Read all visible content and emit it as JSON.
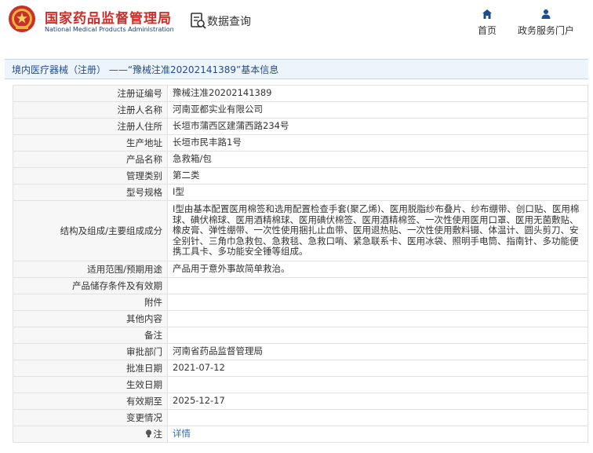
{
  "header": {
    "brand_cn": "国家药品监督管理局",
    "brand_en": "National Medical Products Administration",
    "query_label": "数据查询",
    "nav_home": "首页",
    "nav_portal": "政务服务门户",
    "colors": {
      "brand_red": "#c9302c",
      "brand_blue": "#1b3f8f"
    }
  },
  "title_bar": "境内医疗器械（注册） ——“豫械注准20202141389”基本信息",
  "rows": [
    {
      "label": "注册证编号",
      "value": "豫械注准20202141389"
    },
    {
      "label": "注册人名称",
      "value": "河南亚都实业有限公司"
    },
    {
      "label": "注册人住所",
      "value": "长垣市蒲西区建蒲西路234号"
    },
    {
      "label": "生产地址",
      "value": "长垣市民丰路1号"
    },
    {
      "label": "产品名称",
      "value": "急救箱/包"
    },
    {
      "label": "管理类别",
      "value": "第二类"
    },
    {
      "label": "型号规格",
      "value": "Ⅰ型"
    },
    {
      "label": "结构及组成/主要组成成分",
      "value": "Ⅰ型由基本配置医用棉签和选用配置检查手套(聚乙烯)、医用脱脂纱布叠片、纱布绷带、创口贴、医用棉球、碘伏棉球、医用酒精棉球、医用碘伏棉签、医用酒精棉签、一次性使用医用口罩、医用无菌敷贴、橡皮膏、弹性绷带、一次性使用捆扎止血带、医用退热贴、一次性使用敷料镊、体温计、圆头剪刀、安全别针、三角巾急救包、急救毯、急救口哨、紧急联系卡、医用冰袋、照明手电筒、指南针、多功能便携工具卡、多功能安全锤等组成。"
    },
    {
      "label": "适用范围/预期用途",
      "value": "产品用于意外事故简单救治。"
    },
    {
      "label": "产品储存条件及有效期",
      "value": ""
    },
    {
      "label": "附件",
      "value": ""
    },
    {
      "label": "其他内容",
      "value": ""
    },
    {
      "label": "备注",
      "value": ""
    },
    {
      "label": "审批部门",
      "value": "河南省药品监督管理局"
    },
    {
      "label": "批准日期",
      "value": "2021-07-12"
    },
    {
      "label": "生效日期",
      "value": ""
    },
    {
      "label": "有效期至",
      "value": "2025-12-17"
    },
    {
      "label": "变更情况",
      "value": ""
    },
    {
      "label": "注",
      "value": "详情"
    }
  ]
}
